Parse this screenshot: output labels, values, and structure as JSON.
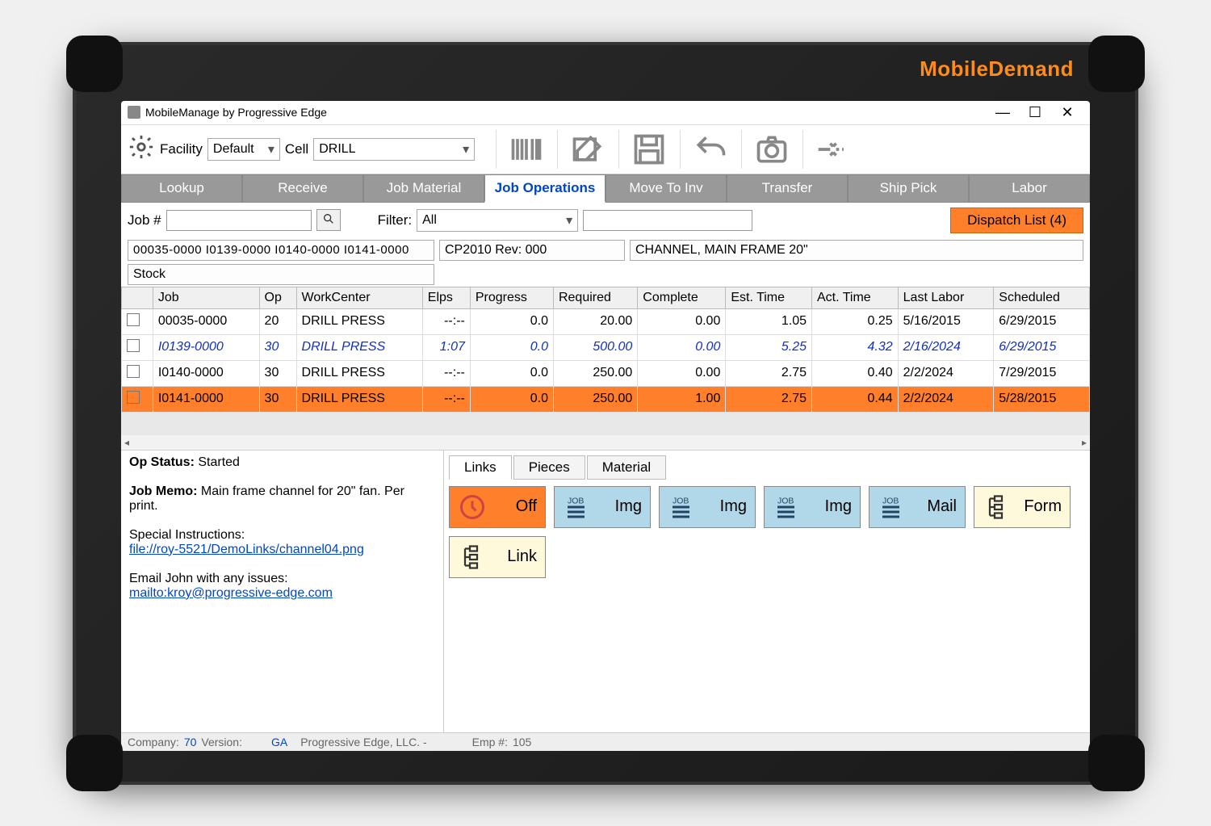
{
  "brand": "MobileDemand",
  "window": {
    "title": "MobileManage by Progressive Edge"
  },
  "toolbar": {
    "facility_label": "Facility",
    "facility_value": "Default",
    "cell_label": "Cell",
    "cell_value": "DRILL"
  },
  "tabs": [
    "Lookup",
    "Receive",
    "Job Material",
    "Job Operations",
    "Move To Inv",
    "Transfer",
    "Ship Pick",
    "Labor"
  ],
  "active_tab": 3,
  "filter": {
    "job_label": "Job #",
    "job_value": "",
    "filter_label": "Filter:",
    "filter_value": "All",
    "search_value": "",
    "dispatch": "Dispatch List (4)"
  },
  "info": {
    "job_ids": "00035-0000  I0139-0000  I0140-0000  I0141-0000",
    "part": "CP2010 Rev: 000",
    "desc": "CHANNEL, MAIN FRAME 20\"",
    "stock": "Stock"
  },
  "columns": [
    "",
    "Job",
    "Op",
    "WorkCenter",
    "Elps",
    "Progress",
    "Required",
    "Complete",
    "Est. Time",
    "Act. Time",
    "Last Labor",
    "Scheduled"
  ],
  "rows": [
    {
      "job": "00035-0000",
      "op": "20",
      "wc": "DRILL PRESS",
      "elps": "--:--",
      "prog": "0.0",
      "req": "20.00",
      "comp": "0.00",
      "est": "1.05",
      "act": "0.25",
      "last": "5/16/2015",
      "sched": "6/29/2015",
      "style": ""
    },
    {
      "job": "I0139-0000",
      "op": "30",
      "wc": "DRILL PRESS",
      "elps": "1:07",
      "prog": "0.0",
      "req": "500.00",
      "comp": "0.00",
      "est": "5.25",
      "act": "4.32",
      "last": "2/16/2024",
      "sched": "6/29/2015",
      "style": "bluei"
    },
    {
      "job": "I0140-0000",
      "op": "30",
      "wc": "DRILL PRESS",
      "elps": "--:--",
      "prog": "0.0",
      "req": "250.00",
      "comp": "0.00",
      "est": "2.75",
      "act": "0.40",
      "last": "2/2/2024",
      "sched": "7/29/2015",
      "style": ""
    },
    {
      "job": "I0141-0000",
      "op": "30",
      "wc": "DRILL PRESS",
      "elps": "--:--",
      "prog": "0.0",
      "req": "250.00",
      "comp": "1.00",
      "est": "2.75",
      "act": "0.44",
      "last": "2/2/2024",
      "sched": "5/28/2015",
      "style": "sel"
    }
  ],
  "details": {
    "op_status_label": "Op Status:",
    "op_status": "Started",
    "memo_label": "Job Memo:",
    "memo": "Main frame channel for 20\" fan.  Per print.",
    "special_label": "Special Instructions:",
    "special_link": "file://roy-5521/DemoLinks/channel04.png",
    "email_text": "Email John with any issues: ",
    "email_link": "mailto:kroy@progressive-edge.com"
  },
  "subtabs": [
    "Links",
    "Pieces",
    "Material"
  ],
  "active_subtab": 0,
  "linkbuttons": [
    {
      "label": "Off",
      "style": "orange",
      "icon": "clock"
    },
    {
      "label": "Img",
      "style": "blue",
      "icon": "job"
    },
    {
      "label": "Img",
      "style": "blue",
      "icon": "job"
    },
    {
      "label": "Img",
      "style": "blue",
      "icon": "job"
    },
    {
      "label": "Mail",
      "style": "blue",
      "icon": "job"
    },
    {
      "label": "Form",
      "style": "yellow",
      "icon": "flow"
    },
    {
      "label": "Link",
      "style": "yellow",
      "icon": "flow"
    }
  ],
  "status": {
    "company_label": "Company:",
    "company": "70",
    "version_label": "Version:",
    "version": "GA",
    "vendor": "Progressive Edge, LLC.  -",
    "emp_label": "Emp #:",
    "emp": "105"
  }
}
